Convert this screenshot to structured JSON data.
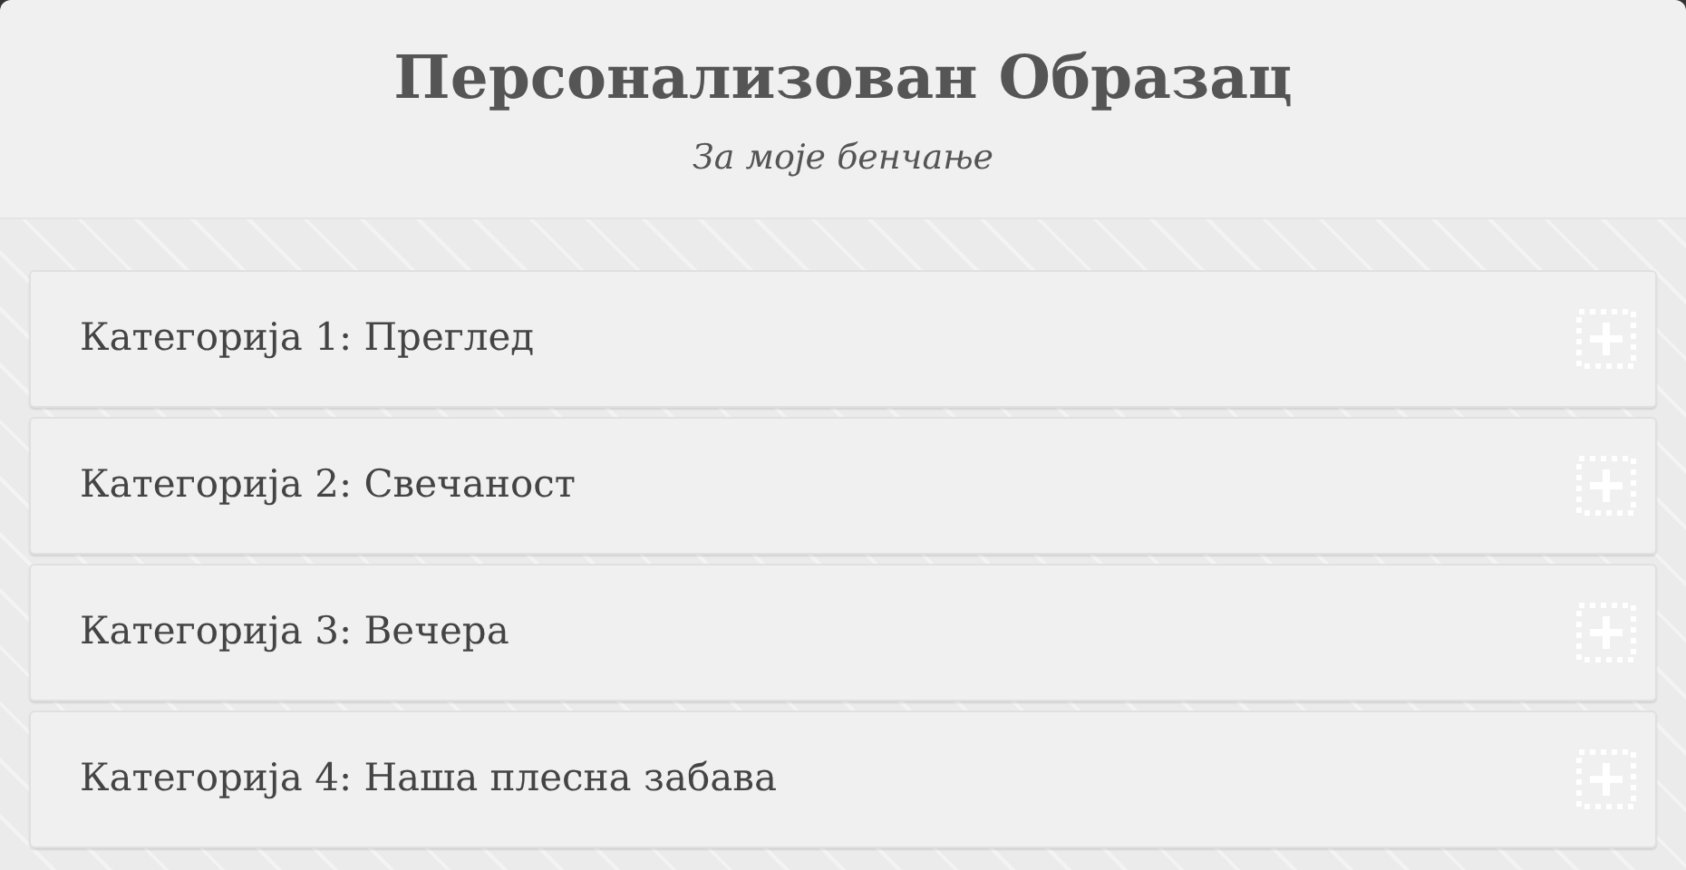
{
  "header": {
    "title": "Персонализован Образац",
    "subtitle": "За моје бенчање"
  },
  "categories": [
    {
      "label": "Категорија 1: Преглед",
      "expanded": false
    },
    {
      "label": "Категорија 2: Свечаност",
      "expanded": false
    },
    {
      "label": "Категорија 3: Вечера",
      "expanded": false
    },
    {
      "label": "Категорија 4: Наша плесна забава",
      "expanded": false
    }
  ]
}
